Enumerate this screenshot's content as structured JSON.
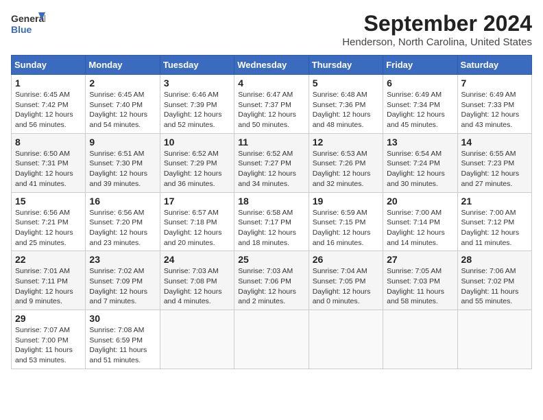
{
  "header": {
    "logo_line1": "General",
    "logo_line2": "Blue",
    "month": "September 2024",
    "location": "Henderson, North Carolina, United States"
  },
  "weekdays": [
    "Sunday",
    "Monday",
    "Tuesday",
    "Wednesday",
    "Thursday",
    "Friday",
    "Saturday"
  ],
  "weeks": [
    [
      {
        "day": "1",
        "sunrise": "6:45 AM",
        "sunset": "7:42 PM",
        "daylight": "12 hours and 56 minutes."
      },
      {
        "day": "2",
        "sunrise": "6:45 AM",
        "sunset": "7:40 PM",
        "daylight": "12 hours and 54 minutes."
      },
      {
        "day": "3",
        "sunrise": "6:46 AM",
        "sunset": "7:39 PM",
        "daylight": "12 hours and 52 minutes."
      },
      {
        "day": "4",
        "sunrise": "6:47 AM",
        "sunset": "7:37 PM",
        "daylight": "12 hours and 50 minutes."
      },
      {
        "day": "5",
        "sunrise": "6:48 AM",
        "sunset": "7:36 PM",
        "daylight": "12 hours and 48 minutes."
      },
      {
        "day": "6",
        "sunrise": "6:49 AM",
        "sunset": "7:34 PM",
        "daylight": "12 hours and 45 minutes."
      },
      {
        "day": "7",
        "sunrise": "6:49 AM",
        "sunset": "7:33 PM",
        "daylight": "12 hours and 43 minutes."
      }
    ],
    [
      {
        "day": "8",
        "sunrise": "6:50 AM",
        "sunset": "7:31 PM",
        "daylight": "12 hours and 41 minutes."
      },
      {
        "day": "9",
        "sunrise": "6:51 AM",
        "sunset": "7:30 PM",
        "daylight": "12 hours and 39 minutes."
      },
      {
        "day": "10",
        "sunrise": "6:52 AM",
        "sunset": "7:29 PM",
        "daylight": "12 hours and 36 minutes."
      },
      {
        "day": "11",
        "sunrise": "6:52 AM",
        "sunset": "7:27 PM",
        "daylight": "12 hours and 34 minutes."
      },
      {
        "day": "12",
        "sunrise": "6:53 AM",
        "sunset": "7:26 PM",
        "daylight": "12 hours and 32 minutes."
      },
      {
        "day": "13",
        "sunrise": "6:54 AM",
        "sunset": "7:24 PM",
        "daylight": "12 hours and 30 minutes."
      },
      {
        "day": "14",
        "sunrise": "6:55 AM",
        "sunset": "7:23 PM",
        "daylight": "12 hours and 27 minutes."
      }
    ],
    [
      {
        "day": "15",
        "sunrise": "6:56 AM",
        "sunset": "7:21 PM",
        "daylight": "12 hours and 25 minutes."
      },
      {
        "day": "16",
        "sunrise": "6:56 AM",
        "sunset": "7:20 PM",
        "daylight": "12 hours and 23 minutes."
      },
      {
        "day": "17",
        "sunrise": "6:57 AM",
        "sunset": "7:18 PM",
        "daylight": "12 hours and 20 minutes."
      },
      {
        "day": "18",
        "sunrise": "6:58 AM",
        "sunset": "7:17 PM",
        "daylight": "12 hours and 18 minutes."
      },
      {
        "day": "19",
        "sunrise": "6:59 AM",
        "sunset": "7:15 PM",
        "daylight": "12 hours and 16 minutes."
      },
      {
        "day": "20",
        "sunrise": "7:00 AM",
        "sunset": "7:14 PM",
        "daylight": "12 hours and 14 minutes."
      },
      {
        "day": "21",
        "sunrise": "7:00 AM",
        "sunset": "7:12 PM",
        "daylight": "12 hours and 11 minutes."
      }
    ],
    [
      {
        "day": "22",
        "sunrise": "7:01 AM",
        "sunset": "7:11 PM",
        "daylight": "12 hours and 9 minutes."
      },
      {
        "day": "23",
        "sunrise": "7:02 AM",
        "sunset": "7:09 PM",
        "daylight": "12 hours and 7 minutes."
      },
      {
        "day": "24",
        "sunrise": "7:03 AM",
        "sunset": "7:08 PM",
        "daylight": "12 hours and 4 minutes."
      },
      {
        "day": "25",
        "sunrise": "7:03 AM",
        "sunset": "7:06 PM",
        "daylight": "12 hours and 2 minutes."
      },
      {
        "day": "26",
        "sunrise": "7:04 AM",
        "sunset": "7:05 PM",
        "daylight": "12 hours and 0 minutes."
      },
      {
        "day": "27",
        "sunrise": "7:05 AM",
        "sunset": "7:03 PM",
        "daylight": "11 hours and 58 minutes."
      },
      {
        "day": "28",
        "sunrise": "7:06 AM",
        "sunset": "7:02 PM",
        "daylight": "11 hours and 55 minutes."
      }
    ],
    [
      {
        "day": "29",
        "sunrise": "7:07 AM",
        "sunset": "7:00 PM",
        "daylight": "11 hours and 53 minutes."
      },
      {
        "day": "30",
        "sunrise": "7:08 AM",
        "sunset": "6:59 PM",
        "daylight": "11 hours and 51 minutes."
      },
      null,
      null,
      null,
      null,
      null
    ]
  ],
  "labels": {
    "sunrise": "Sunrise:",
    "sunset": "Sunset:",
    "daylight": "Daylight:"
  }
}
